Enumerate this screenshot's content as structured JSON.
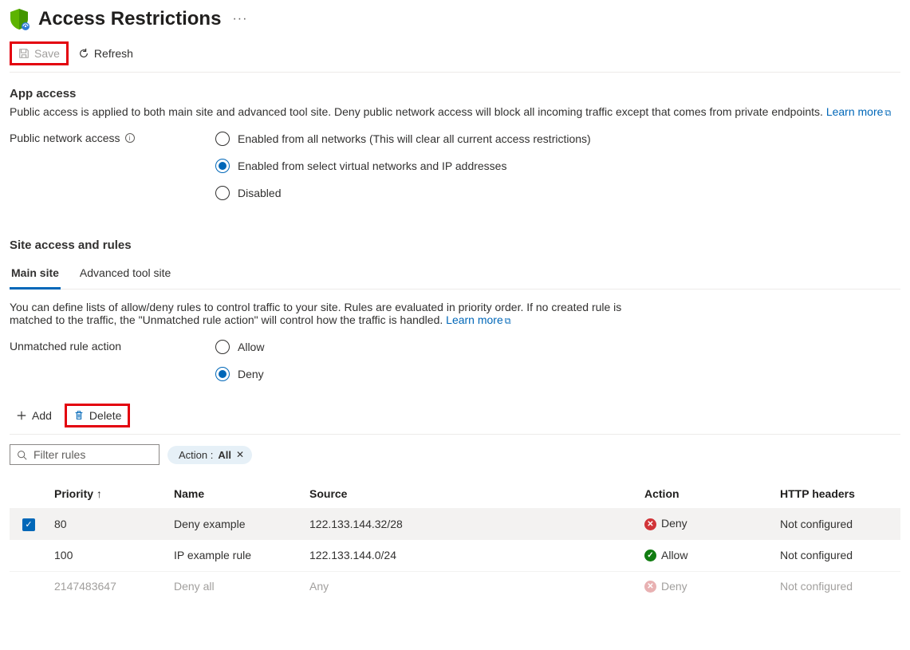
{
  "header": {
    "title": "Access Restrictions"
  },
  "toolbar": {
    "save_label": "Save",
    "refresh_label": "Refresh"
  },
  "app_access": {
    "heading": "App access",
    "description": "Public access is applied to both main site and advanced tool site. Deny public network access will block all incoming traffic except that comes from private endpoints.",
    "learn_more": "Learn more",
    "public_label": "Public network access",
    "options": [
      "Enabled from all networks (This will clear all current access restrictions)",
      "Enabled from select virtual networks and IP addresses",
      "Disabled"
    ],
    "selected": 1
  },
  "site_rules": {
    "heading": "Site access and rules",
    "tabs": [
      "Main site",
      "Advanced tool site"
    ],
    "active_tab": 0,
    "description_a": "You can define lists of allow/deny rules to control traffic to your site. Rules are evaluated in priority order. If no created rule is matched to the traffic, the \"Unmatched rule action\" will control how the traffic is handled.",
    "learn_more": "Learn more",
    "unmatched_label": "Unmatched rule action",
    "unmatched_options": [
      "Allow",
      "Deny"
    ],
    "unmatched_selected": 1
  },
  "rules_toolbar": {
    "add_label": "Add",
    "delete_label": "Delete"
  },
  "filter": {
    "placeholder": "Filter rules",
    "pill_key": "Action :",
    "pill_value": "All"
  },
  "table": {
    "columns": [
      "Priority ↑",
      "Name",
      "Source",
      "Action",
      "HTTP headers"
    ],
    "rows": [
      {
        "checked": true,
        "priority": "80",
        "name": "Deny example",
        "source": "122.133.144.32/28",
        "action": "Deny",
        "action_icon": "deny",
        "http": "Not configured",
        "state": "selected"
      },
      {
        "checked": false,
        "priority": "100",
        "name": "IP example rule",
        "source": "122.133.144.0/24",
        "action": "Allow",
        "action_icon": "allow",
        "http": "Not configured",
        "state": "normal"
      },
      {
        "checked": false,
        "priority": "2147483647",
        "name": "Deny all",
        "source": "Any",
        "action": "Deny",
        "action_icon": "deny",
        "http": "Not configured",
        "state": "disabled"
      }
    ]
  }
}
